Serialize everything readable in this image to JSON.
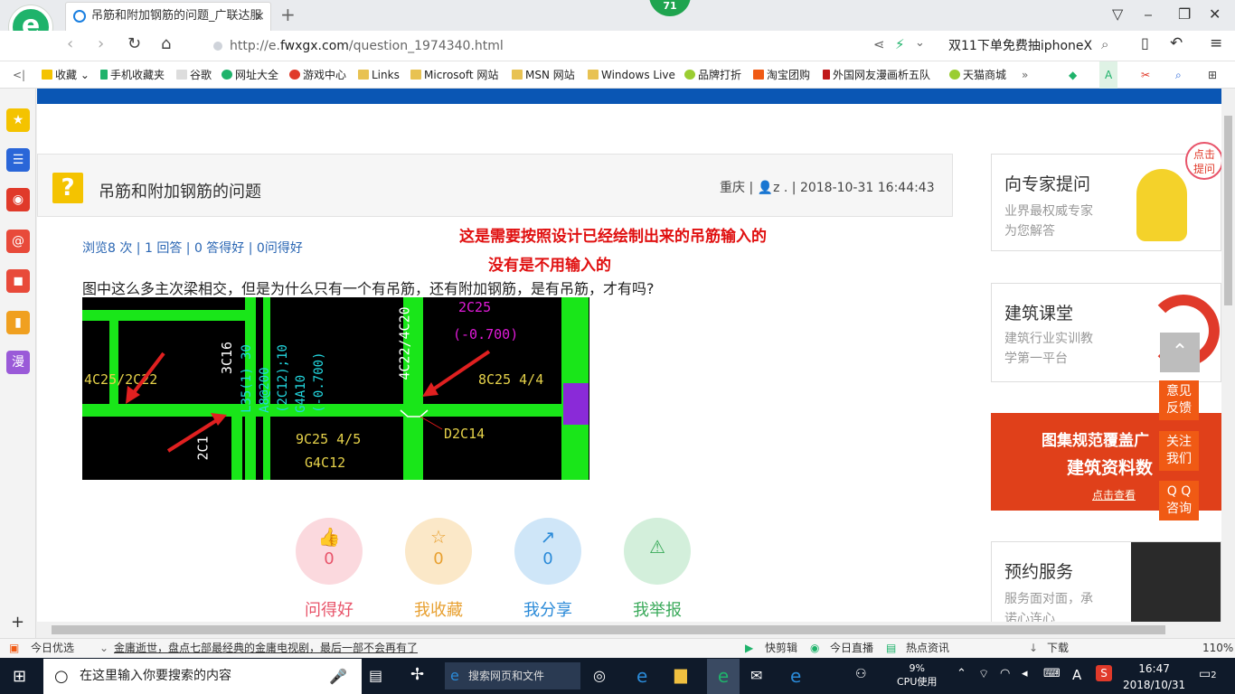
{
  "browser": {
    "badge": "71",
    "tab_title": "吊筋和附加钢筋的问题_广联达服",
    "tab_close": "×",
    "new_tab": "+",
    "url_prefix": "http://e.",
    "url_domain": "fwxgx.com",
    "url_path": "/question_1974340.html",
    "promo": "双11下单免费抽iphoneX",
    "window_controls": [
      "⎯",
      "❐",
      "✕"
    ]
  },
  "bookmarks": [
    {
      "label": "收藏",
      "color": "#f4c300"
    },
    {
      "label": "手机收藏夹",
      "color": "#1fb36b"
    },
    {
      "label": "谷歌",
      "color": "#bbbbbb"
    },
    {
      "label": "网址大全",
      "color": "#1fb36b"
    },
    {
      "label": "游戏中心",
      "color": "#e03a2a"
    },
    {
      "label": "Links",
      "color": "#e8c252"
    },
    {
      "label": "Microsoft 网站",
      "color": "#e8c252"
    },
    {
      "label": "MSN 网站",
      "color": "#e8c252"
    },
    {
      "label": "Windows Live",
      "color": "#e8c252"
    },
    {
      "label": "品牌打折",
      "color": "#9acd32"
    },
    {
      "label": "淘宝团购",
      "color": "#f05a14"
    },
    {
      "label": "外国网友漫画析五队",
      "color": "#c0181a"
    },
    {
      "label": "天猫商城",
      "color": "#9acd32"
    }
  ],
  "sidebar_icons": [
    {
      "name": "favorites-icon",
      "glyph": "★",
      "color": "#f4c300"
    },
    {
      "name": "news-icon",
      "glyph": "☰",
      "color": "#2a66d8"
    },
    {
      "name": "weibo-icon",
      "glyph": "◉",
      "color": "#e03a2a"
    },
    {
      "name": "mail-icon",
      "glyph": "@",
      "color": "#e84a3a"
    },
    {
      "name": "game-icon",
      "glyph": "◼",
      "color": "#e84a3a"
    },
    {
      "name": "book-icon",
      "glyph": "▮",
      "color": "#f0a020"
    },
    {
      "name": "manga-icon",
      "glyph": "漫",
      "color": "#9a5ad8"
    }
  ],
  "question": {
    "title": "吊筋和附加钢筋的问题",
    "location": "重庆",
    "user": "z .",
    "datetime": "2018-10-31 16:44:43",
    "stats": "浏览8 次 | 1 回答 | 0 答得好 | 0问得好",
    "body": "图中这么多主次梁相交，但是为什么只有一个有吊筋，还有附加钢筋，是有吊筋，才有吗?",
    "annotation_line1": "这是需要按照设计已经绘制出来的吊筋输入的",
    "annotation_line2": "没有是不用输入的"
  },
  "cad_labels": {
    "a": "4C25/2C22",
    "b": "3C16",
    "c": "4C22/4C20",
    "d": "2C25",
    "e": "(-0.700)",
    "f": "8C25 4/4",
    "g": "9C25 4/5",
    "h": "G4C12",
    "i": "D2C14",
    "j": "2C1",
    "k1": "L35(1) 30",
    "k2": "A8@200",
    "k3": "(2C12);10",
    "k4": "G4A10",
    "k5": "(-0.700)"
  },
  "actions": [
    {
      "count": "0",
      "label": "问得好",
      "color": "#e8546a",
      "bg": "#fbd9de",
      "glyph": "👍"
    },
    {
      "count": "0",
      "label": "我收藏",
      "color": "#e8a030",
      "bg": "#fbe8c8",
      "glyph": "☆"
    },
    {
      "count": "0",
      "label": "我分享",
      "color": "#2a8ad8",
      "bg": "#cfe6f8",
      "glyph": "↗"
    },
    {
      "count": "0",
      "label": "我举报",
      "color": "#3aaa5a",
      "bg": "#d3efdb",
      "glyph": "⚠"
    }
  ],
  "right_cards": [
    {
      "title": "向专家提问",
      "sub1": "业界最权威专家",
      "sub2": "为您解答"
    },
    {
      "title": "建筑课堂",
      "sub1": "建筑行业实训教",
      "sub2": "学第一平台"
    },
    {
      "title": "预约服务",
      "sub1": "服务面对面，承",
      "sub2": "诺心连心"
    }
  ],
  "banner": {
    "line1": "图集规范覆盖广",
    "line2": "建筑资料数",
    "cta": "点击查看"
  },
  "float_buttons": [
    "意见\n反馈",
    "关注\n我们",
    "Q Q\n咨询"
  ],
  "bubble": "点击\n提问",
  "status": {
    "left_label": "今日优选",
    "news": "金庸逝世，盘点七部最经典的金庸电视剧，最后一部不会再有了",
    "items": [
      "快剪辑",
      "今日直播",
      "热点资讯",
      "下载"
    ],
    "zoom": "110%"
  },
  "taskbar": {
    "search_placeholder": "在这里输入你要搜索的内容",
    "web_search": "搜索网页和文件",
    "cpu_pct": "9%",
    "cpu_label": "CPU使用",
    "ime": "A",
    "time": "16:47",
    "date": "2018/10/31",
    "notif": "2"
  }
}
